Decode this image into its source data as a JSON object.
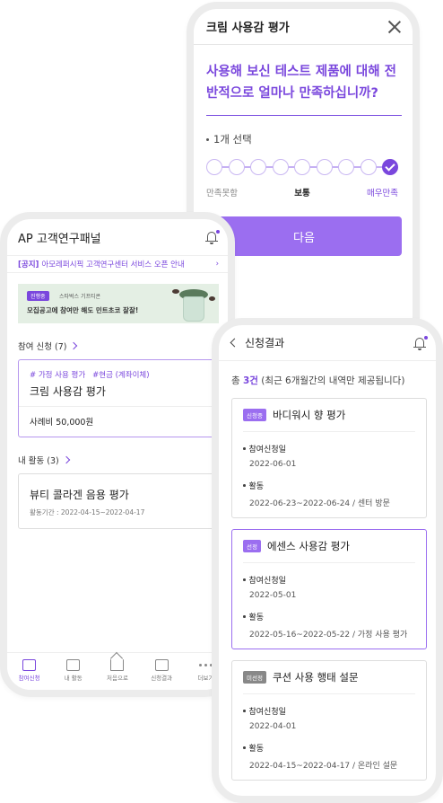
{
  "survey": {
    "title": "크림 사용감 평가",
    "question": "사용해 보신 테스트 제품에 대해 전반적으로 얼마나 만족하십니까?",
    "select_count": "1개 선택",
    "scale_points": 9,
    "selected_index": 8,
    "label_left": "만족못함",
    "label_mid": "보통",
    "label_right": "매우만족",
    "next_button": "다음"
  },
  "panel": {
    "app_title": "AP 고객연구패널",
    "notice_tag": "[공지]",
    "notice_text": "아모레퍼시픽 고객연구센터 서비스 오픈 안내",
    "banner": {
      "tag": "진행중",
      "sub": "스타벅스 기프티콘",
      "main": "모집공고에 참여만 해도 민트초코 잘잘!"
    },
    "apply_section": "참여 신청 (7)",
    "apply_card": {
      "tag1": "# 가정 사용 평가",
      "tag2": "#현금 (계좌이체)",
      "name": "크림 사용감 평가",
      "fee": "사례비 50,000원"
    },
    "activity_section": "내 활동 (3)",
    "activity_card": {
      "name": "뷰티 콜라겐 음용 평가",
      "period": "활동기간 : 2022-04-15~2022-04-17"
    },
    "tabs": [
      "참여신청",
      "내 활동",
      "처음으로",
      "신청결과",
      "더보기"
    ]
  },
  "result": {
    "title": "신청결과",
    "summary_prefix": "총 ",
    "summary_count": "3건",
    "summary_suffix": " (최근 6개월간의 내역만 제공됩니다)",
    "cards": [
      {
        "badge": "신청중",
        "title": "바디워시 향 평가",
        "apply_label": "참여신청일",
        "apply_date": "2022-06-01",
        "activity_label": "활동",
        "activity_value": "2022-06-23~2022-06-24 / 센터 방문"
      },
      {
        "badge": "선정",
        "title": "에센스 사용감 평가",
        "apply_label": "참여신청일",
        "apply_date": "2022-05-01",
        "activity_label": "활동",
        "activity_value": "2022-05-16~2022-05-22 / 가정 사용 평가"
      },
      {
        "badge": "미선정",
        "title": "쿠션 사용 행태 설문",
        "apply_label": "참여신청일",
        "apply_date": "2022-04-01",
        "activity_label": "활동",
        "activity_value": "2022-04-15~2022-04-17 / 온라인 설문"
      }
    ]
  },
  "colors": {
    "accent": "#7a47dd",
    "button": "#9b6ef0",
    "frame": "#ececec"
  }
}
